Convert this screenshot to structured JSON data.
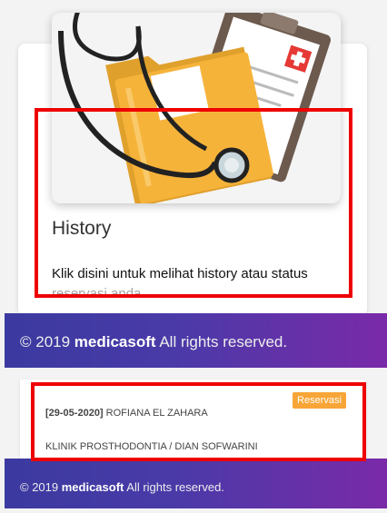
{
  "history_card": {
    "title": "History",
    "description": "Klik disini untuk melihat history atau status",
    "description_cont": "reservasi anda"
  },
  "footer_top": {
    "prefix": "© 2019 ",
    "brand": "medicasoft",
    "suffix": " All rights reserved."
  },
  "reservation": {
    "date": "[29-05-2020]",
    "patient": " ROFIANA EL ZAHARA",
    "clinic": "KLINIK PROSTHODONTIA / DIAN SOFWARINI",
    "badge": "Reservasi"
  },
  "footer_bottom": {
    "prefix": "© 2019 ",
    "brand": "medicasoft",
    "suffix": " All rights reserved."
  },
  "colors": {
    "highlight": "#ee0000",
    "badge": "#f7a536",
    "footer_start": "#3b3aa0",
    "footer_end": "#7a2aa8",
    "folder": "#f6b33a"
  },
  "icons": {
    "card_illustration": "medical-folder-stethoscope-icon"
  }
}
